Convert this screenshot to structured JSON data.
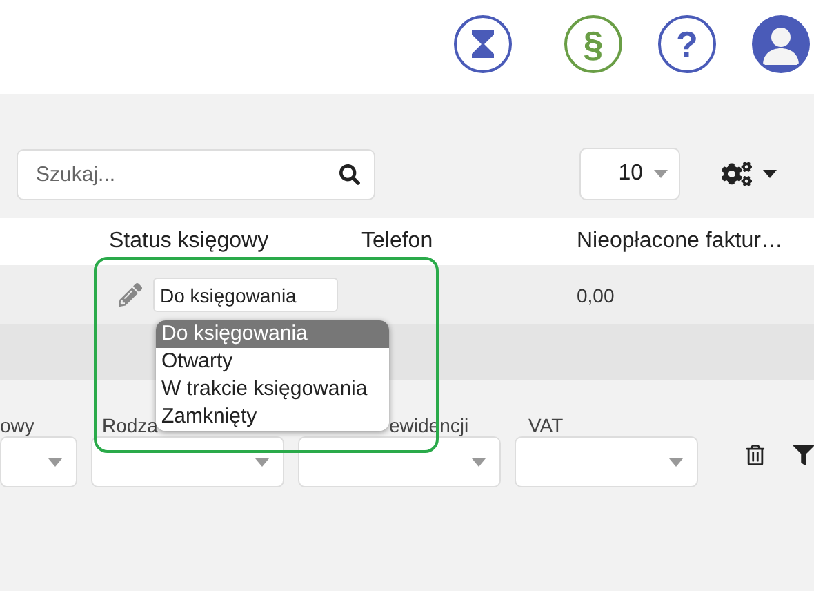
{
  "header_icons": [
    {
      "kind": "hourglass"
    },
    {
      "kind": "paragraph",
      "symbol": "§"
    },
    {
      "kind": "help",
      "symbol": "?"
    },
    {
      "kind": "user"
    }
  ],
  "search": {
    "placeholder": "Szukaj..."
  },
  "page_size": "10",
  "table": {
    "columns": [
      "Status księgowy",
      "Telefon",
      "Nieopłacone faktur…"
    ],
    "rows": [
      {
        "status": "Do księgowania",
        "telefon": "",
        "unpaid": "0,00"
      }
    ]
  },
  "status_dropdown": {
    "options": [
      {
        "label": "Do księgowania",
        "selected": true
      },
      {
        "label": "Otwarty",
        "selected": false
      },
      {
        "label": "W trakcie księgowania",
        "selected": false
      },
      {
        "label": "Zamknięty",
        "selected": false
      }
    ]
  },
  "filters": [
    {
      "label": "owy"
    },
    {
      "label": "Rodza"
    },
    {
      "label": "ewidencji"
    },
    {
      "label": "VAT"
    }
  ]
}
